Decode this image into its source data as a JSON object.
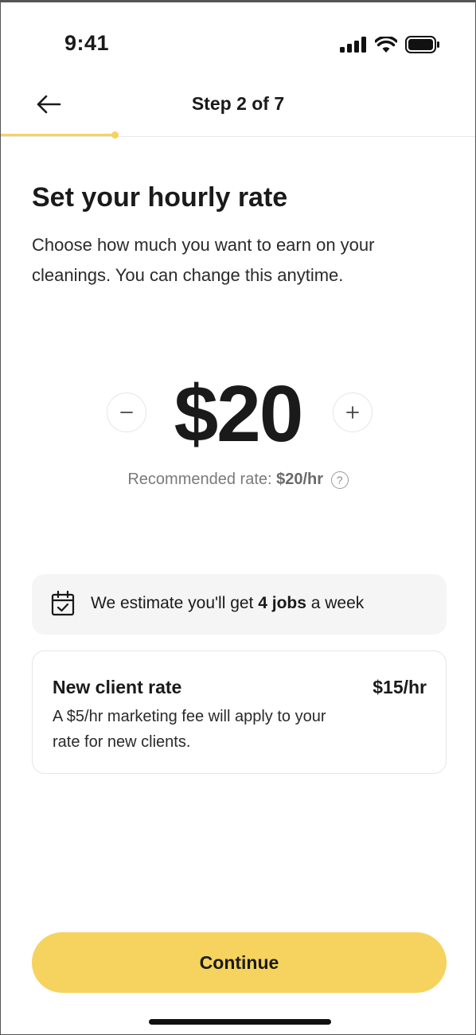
{
  "status_bar": {
    "time": "9:41"
  },
  "nav": {
    "title": "Step 2 of 7",
    "progress_fraction": 0.24
  },
  "content": {
    "title": "Set your hourly rate",
    "subtitle": "Choose how much you want to earn on your cleanings. You can change this anytime.",
    "rate_value": "$20",
    "recommended_prefix": "Recommended rate: ",
    "recommended_value": "$20/hr",
    "help_icon_glyph": "?"
  },
  "estimate": {
    "prefix": "We estimate you'll get ",
    "highlight": "4 jobs",
    "suffix": " a week"
  },
  "client_rate": {
    "title": "New client rate",
    "price": "$15/hr",
    "description": "A $5/hr marketing fee will apply to your rate for new clients."
  },
  "actions": {
    "continue_label": "Continue"
  },
  "colors": {
    "accent": "#f5d35e",
    "card_bg": "#f5f5f5"
  },
  "icons": [
    "back-arrow-icon",
    "signal-icon",
    "wifi-icon",
    "battery-icon",
    "minus-icon",
    "plus-icon",
    "help-icon",
    "calendar-check-icon"
  ]
}
